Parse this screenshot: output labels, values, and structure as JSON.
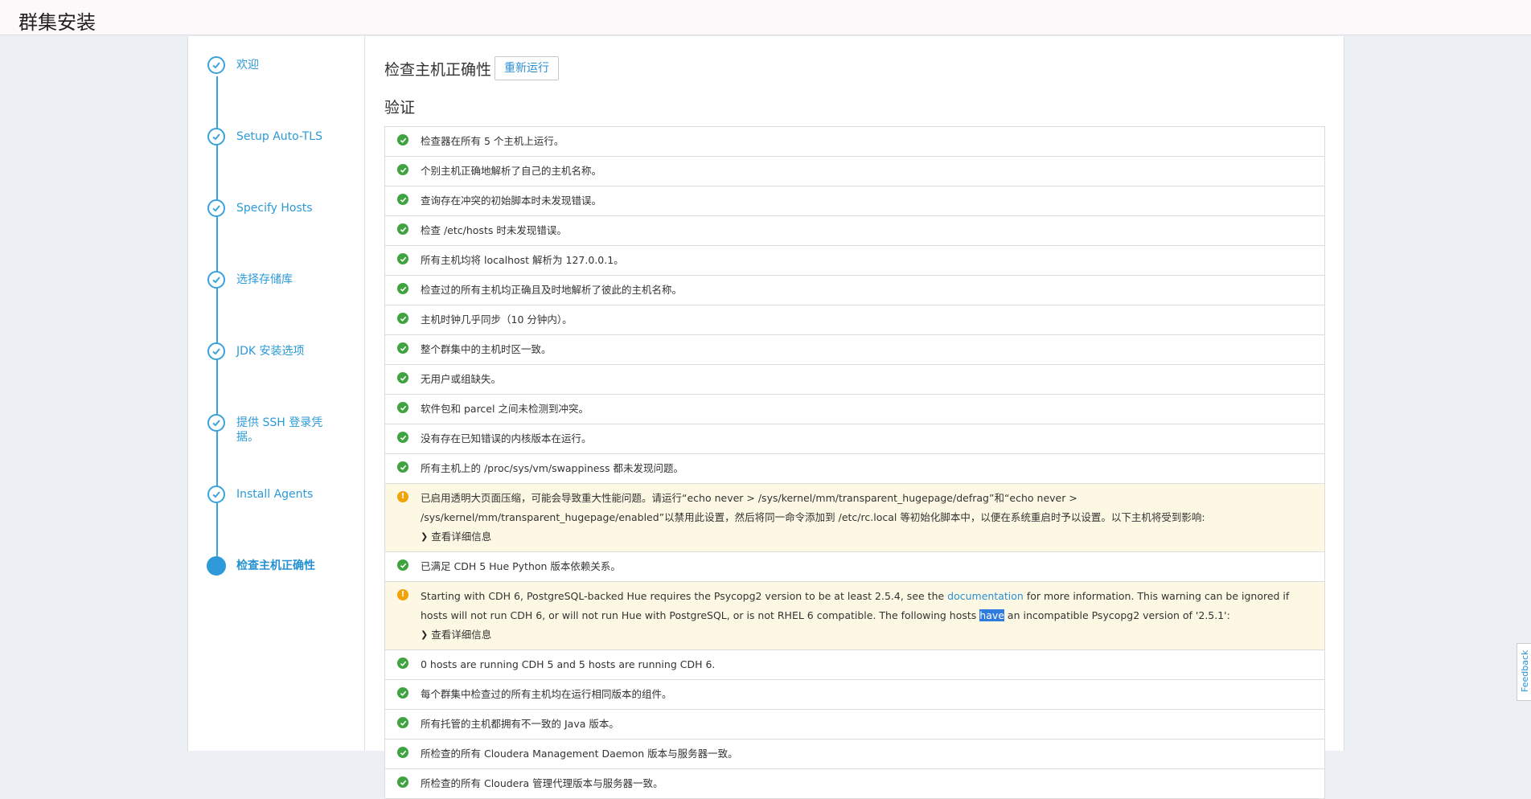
{
  "header": {
    "title": "群集安装"
  },
  "steps": [
    {
      "label": "欢迎",
      "state": "done"
    },
    {
      "label": "Setup Auto-TLS",
      "state": "done"
    },
    {
      "label": "Specify Hosts",
      "state": "done"
    },
    {
      "label": "选择存储库",
      "state": "done"
    },
    {
      "label": "JDK 安装选项",
      "state": "done"
    },
    {
      "label": "提供 SSH 登录凭据。",
      "state": "done"
    },
    {
      "label": "Install Agents",
      "state": "done"
    },
    {
      "label": "检查主机正确性",
      "state": "active"
    }
  ],
  "main": {
    "title": "检查主机正确性",
    "rerun_label": "重新运行",
    "section": "验证",
    "details_label": "查看详细信息",
    "checks": [
      {
        "status": "ok",
        "text": "检查器在所有 5 个主机上运行。"
      },
      {
        "status": "ok",
        "text": "个别主机正确地解析了自己的主机名称。"
      },
      {
        "status": "ok",
        "text": "查询存在冲突的初始脚本时未发现错误。"
      },
      {
        "status": "ok",
        "text": "检查 /etc/hosts 时未发现错误。"
      },
      {
        "status": "ok",
        "text": "所有主机均将 localhost 解析为 127.0.0.1。"
      },
      {
        "status": "ok",
        "text": "检查过的所有主机均正确且及时地解析了彼此的主机名称。"
      },
      {
        "status": "ok",
        "text": "主机时钟几乎同步（10 分钟内）。"
      },
      {
        "status": "ok",
        "text": "整个群集中的主机时区一致。"
      },
      {
        "status": "ok",
        "text": "无用户或组缺失。"
      },
      {
        "status": "ok",
        "text": "软件包和 parcel 之间未检测到冲突。"
      },
      {
        "status": "ok",
        "text": "没有存在已知错误的内核版本在运行。"
      },
      {
        "status": "ok",
        "text": "所有主机上的 /proc/sys/vm/swappiness 都未发现问题。"
      },
      {
        "status": "warn",
        "text": "已启用透明大页面压缩，可能会导致重大性能问题。请运行“echo never > /sys/kernel/mm/transparent_hugepage/defrag”和“echo never > /sys/kernel/mm/transparent_hugepage/enabled”以禁用此设置，然后将同一命令添加到 /etc/rc.local 等初始化脚本中，以便在系统重启时予以设置。以下主机将受到影响:"
      },
      {
        "status": "ok",
        "text": "已满足 CDH 5 Hue Python 版本依赖关系。"
      },
      {
        "status": "warn",
        "text_a": "Starting with CDH 6, PostgreSQL-backed Hue requires the Psycopg2 version to be at least 2.5.4, see the ",
        "link": "documentation",
        "text_b": " for more information. This warning can be ignored if hosts will not run CDH 6, or will not run Hue with PostgreSQL, or is not RHEL 6 compatible. The following hosts ",
        "highlight": "have",
        "text_c": " an incompatible Psycopg2 version of '2.5.1':"
      },
      {
        "status": "ok",
        "text": "0 hosts are running CDH 5 and 5 hosts are running CDH 6."
      },
      {
        "status": "ok",
        "text": "每个群集中检查过的所有主机均在运行相同版本的组件。"
      },
      {
        "status": "ok",
        "text": "所有托管的主机都拥有不一致的 Java 版本。"
      },
      {
        "status": "ok",
        "text": "所检查的所有 Cloudera Management Daemon 版本与服务器一致。"
      },
      {
        "status": "ok",
        "text": "所检查的所有 Cloudera 管理代理版本与服务器一致。"
      }
    ]
  },
  "feedback_label": "Feedback",
  "colors": {
    "accent": "#2b9ad9",
    "ok": "#3fa33f",
    "warn": "#f0a30a",
    "warn_bg": "#fcf8e3"
  }
}
